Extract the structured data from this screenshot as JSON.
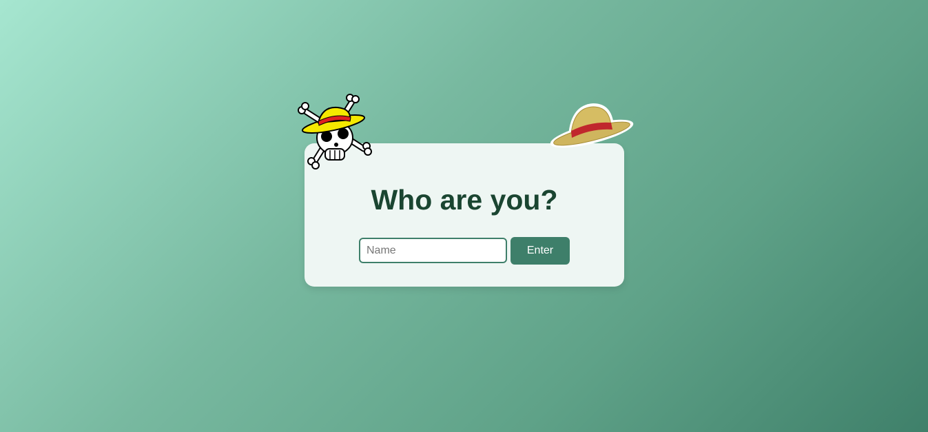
{
  "login": {
    "title": "Who are you?",
    "name_placeholder": "Name",
    "name_value": "",
    "enter_label": "Enter"
  },
  "icons": {
    "jolly_roger": "straw-hat-jolly-roger-icon",
    "straw_hat": "straw-hat-icon"
  },
  "colors": {
    "accent": "#3e7f6a",
    "title": "#1a4531",
    "card_background": "#eef6f3"
  }
}
